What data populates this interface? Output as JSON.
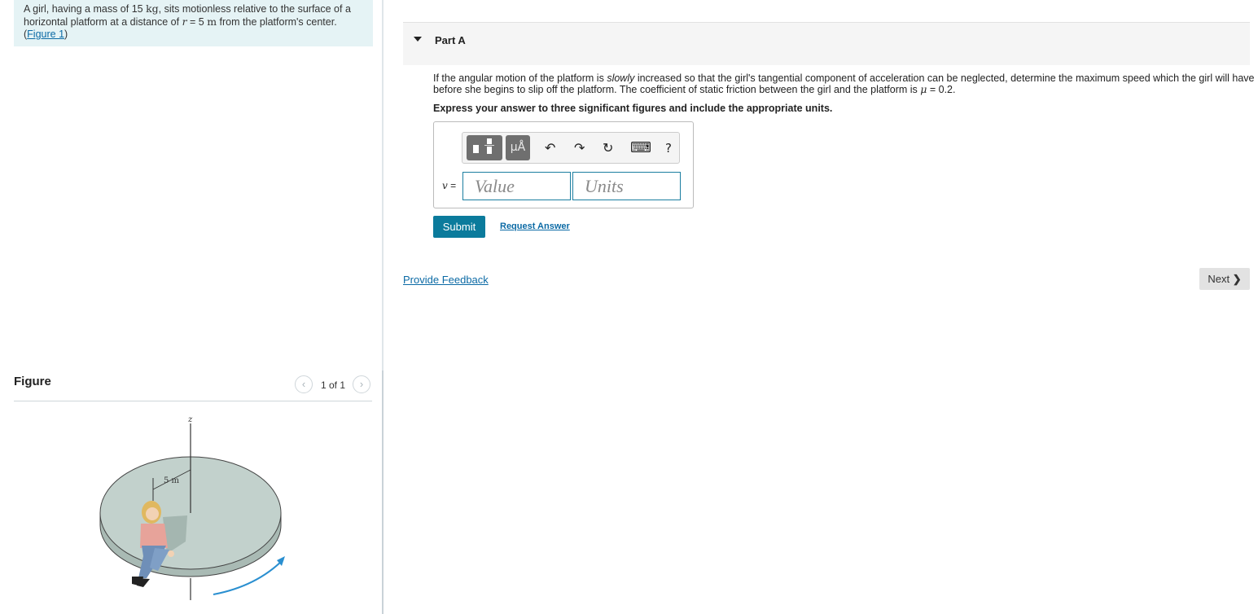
{
  "problem": {
    "text_1": "A girl, having a mass of 15 ",
    "unit_kg": "kg",
    "text_2": ", sits motionless relative to the surface of a horizontal platform at a distance of ",
    "var_r": "r",
    "text_3": " = 5 ",
    "unit_m": "m",
    "text_4": " from the platform's center. (",
    "figure_link": "Figure 1",
    "text_5": ")"
  },
  "figure": {
    "title": "Figure",
    "pager": "1 of 1",
    "axis_label": "z",
    "radius_label": "5 m"
  },
  "part": {
    "title": "Part A",
    "question_1": "If the angular motion of the platform is ",
    "question_em": "slowly",
    "question_2": " increased so that the girl's tangential component of acceleration can be neglected, determine the maximum speed which the girl will have before she begins to slip off the platform. The coefficient of static friction between the girl and the platform is ",
    "mu": "μ",
    "question_3": " = 0.2.",
    "instruction": "Express your answer to three significant figures and include the appropriate units."
  },
  "answer": {
    "variable": "v",
    "equals": " =",
    "value_placeholder": "Value",
    "units_placeholder": "Units",
    "toolbar": {
      "units_button": "μÅ",
      "undo": "↶",
      "redo": "↷",
      "reset": "↻",
      "keyboard": "⌨",
      "help": "?"
    }
  },
  "actions": {
    "submit": "Submit",
    "request_answer": "Request Answer",
    "provide_feedback": "Provide Feedback",
    "next": "Next"
  },
  "colors": {
    "accent": "#0b7b9c",
    "link": "#0b6aa5",
    "problem_bg": "#e5f3f5",
    "platform": "#c2d1cc"
  }
}
